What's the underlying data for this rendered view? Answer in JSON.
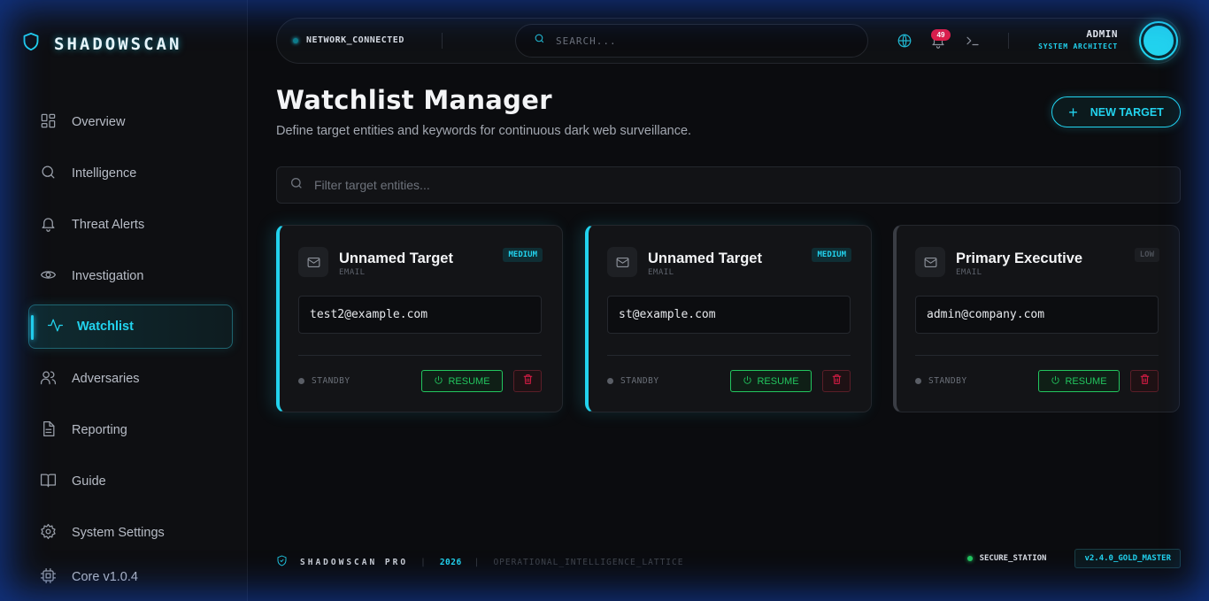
{
  "brand": {
    "name": "SHADOWSCAN"
  },
  "sidebar": {
    "items": [
      {
        "label": "Overview",
        "icon": "grid-icon"
      },
      {
        "label": "Intelligence",
        "icon": "search-icon"
      },
      {
        "label": "Threat Alerts",
        "icon": "bell-icon"
      },
      {
        "label": "Investigation",
        "icon": "eye-icon"
      },
      {
        "label": "Watchlist",
        "icon": "activity-icon",
        "active": true
      },
      {
        "label": "Adversaries",
        "icon": "users-icon"
      },
      {
        "label": "Reporting",
        "icon": "file-icon"
      },
      {
        "label": "Guide",
        "icon": "book-icon"
      },
      {
        "label": "System Settings",
        "icon": "gear-icon"
      },
      {
        "label": "Core v1.0.4",
        "icon": "cpu-icon"
      }
    ]
  },
  "topbar": {
    "network_status": "NETWORK_CONNECTED",
    "search_placeholder": "SEARCH...",
    "notifications_count": "49",
    "user_name": "ADMIN",
    "user_role": "SYSTEM ARCHITECT"
  },
  "header": {
    "title": "Watchlist Manager",
    "subtitle": "Define target entities and keywords for continuous dark web surveillance.",
    "new_target_label": "NEW TARGET"
  },
  "filter": {
    "placeholder": "Filter target entities..."
  },
  "cards": [
    {
      "name": "Unnamed Target",
      "type": "EMAIL",
      "priority": "MEDIUM",
      "value": "test2@example.com",
      "status": "STANDBY",
      "resume_label": "RESUME"
    },
    {
      "name": "Unnamed Target",
      "type": "EMAIL",
      "priority": "MEDIUM",
      "value": "st@example.com",
      "status": "STANDBY",
      "resume_label": "RESUME"
    },
    {
      "name": "Primary Executive",
      "type": "EMAIL",
      "priority": "LOW",
      "value": "admin@company.com",
      "status": "STANDBY",
      "resume_label": "RESUME"
    }
  ],
  "footer": {
    "brand": "SHADOWSCAN PRO",
    "separator": "|",
    "year": "2026",
    "tagline": "OPERATIONAL_INTELLIGENCE_LATTICE",
    "secure_status": "SECURE_STATION",
    "version": "v2.4.0_GOLD_MASTER"
  },
  "colors": {
    "accent": "#22d3ee",
    "success": "#22c55e",
    "danger": "#e11d48",
    "background": "#0b0c0f"
  }
}
